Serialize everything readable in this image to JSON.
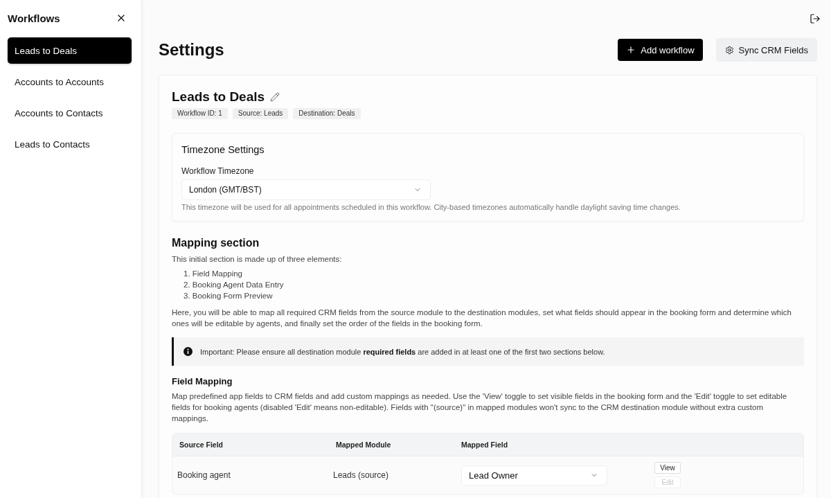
{
  "sidebar": {
    "title": "Workflows",
    "items": [
      {
        "label": "Leads to Deals",
        "selected": true
      },
      {
        "label": "Accounts to Accounts",
        "selected": false
      },
      {
        "label": "Accounts to Contacts",
        "selected": false
      },
      {
        "label": "Leads to Contacts",
        "selected": false
      }
    ]
  },
  "header": {
    "title": "Settings",
    "buttons": [
      {
        "kind": "add",
        "label": "Add workflow"
      },
      {
        "kind": "sync",
        "label": "Sync CRM Fields"
      }
    ]
  },
  "workflow": {
    "name": "Leads to Deals",
    "badges": [
      "Workflow ID: 1",
      "Source: Leads",
      "Destination: Deals"
    ]
  },
  "timezone": {
    "title": "Timezone Settings",
    "label": "Workflow Timezone",
    "value": "London (GMT/BST)",
    "help": "This timezone will be used for all appointments scheduled in this workflow. City-based timezones automatically handle daylight saving time changes."
  },
  "mapping": {
    "title": "Mapping section",
    "intro": "This initial section is made up of three elements:",
    "steps": [
      "1. Field Mapping",
      "2. Booking Agent Data Entry",
      "3. Booking Form Preview"
    ],
    "text": "Here, you will be able to map all required CRM fields from the source module to the destination modules, set what fields should appear in the booking form and determine which ones will be editable by agents, and finally set the order of the fields in the booking form.",
    "alert": "Important: Please ensure all destination module **required fields** are added in at least one of the first two sections below."
  },
  "field_mapping": {
    "title": "Field Mapping",
    "description": "Map predefined app fields to CRM fields and add custom mappings as needed. Use the 'View' toggle to set visible fields in the booking form and the 'Edit' toggle to set editable fields for booking agents (disabled 'Edit' means non-editable). Fields with \"(source)\" in mapped modules won't sync to the CRM destination module without extra custom mappings.",
    "table": {
      "columns": [
        "Source Field",
        "Mapped Module",
        "Mapped Field"
      ],
      "rows": [
        {
          "source": "Booking agent",
          "module": "Leads (source)",
          "field": "Lead Owner",
          "toggles": [
            {
              "label": "View",
              "disabled": false
            },
            {
              "label": "Edit",
              "disabled": true
            }
          ]
        }
      ]
    }
  }
}
